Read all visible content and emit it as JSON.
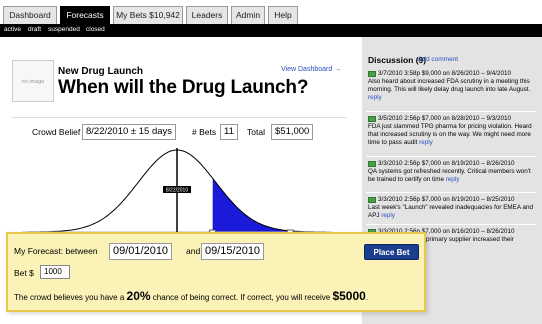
{
  "tabs": [
    {
      "label": "Dashboard",
      "active": false
    },
    {
      "label": "Forecasts",
      "active": true
    },
    {
      "label": "My Bets $10,942",
      "active": false
    },
    {
      "label": "Leaders",
      "active": false
    },
    {
      "label": "Admin",
      "active": false
    },
    {
      "label": "Help",
      "active": false
    }
  ],
  "subnav": [
    "active",
    "draft",
    "suspended",
    "closed"
  ],
  "market": {
    "image_placeholder": "no image",
    "subtitle": "New Drug Launch",
    "title": "When will the Drug Launch?",
    "view_dashboard": "View Dashboard →"
  },
  "stats": {
    "crowd_belief_label": "Crowd Belief",
    "crowd_belief_value": "8/22/2010 ± 15 days",
    "bets_label": "# Bets",
    "bets_value": "11",
    "total_label": "Total",
    "total_value": "$51,000"
  },
  "chart_data": {
    "type": "area",
    "mean_label": "8/22/2010",
    "mean_fraction": 0.5,
    "sigma_fraction": 0.125,
    "selected_range": [
      0.615,
      0.865
    ],
    "colors": {
      "curve": "#000000",
      "selected": "#1a1ad8",
      "mean_line": "#000000"
    }
  },
  "discussion": {
    "title": "Discussion (9)",
    "add_comment": "Add comment",
    "items": [
      {
        "meta": "3/7/2010 3:58p $9,000 on 8/26/2010 – 9/4/2010",
        "text": "Also heard about increased FDA scrutiny in a meeting this morning. This will likely delay drug launch into late August.",
        "reply": "reply"
      },
      {
        "meta": "3/5/2010 2:56p $7,000 on 8/28/2010 – 9/3/2010",
        "text": "FDA just slammed TPG pharma for pricing violation. Heard that increased scrutiny is on the way. We might need more time to pass audit",
        "reply": "reply"
      },
      {
        "meta": "3/3/2010 2:56p $7,000 on 8/19/2010 – 8/26/2010",
        "text": "QA systems got refreshed recently. Critical members won't be trained to certify on time",
        "reply": "reply"
      },
      {
        "meta": "3/3/2010 2:56p $7,000 on 8/19/2010 – 8/25/2010",
        "text": "Last week's \"Launch\" revealed inadequacies for EMEA and APJ",
        "reply": "reply"
      },
      {
        "meta": "3/3/2010 2:56p $7,000 on 8/16/2010 – 8/26/2010",
        "text": "primary supplier increased their",
        "reply": ""
      }
    ]
  },
  "forecast": {
    "label_prefix": "My Forecast: between",
    "date_start": "09/01/2010",
    "and_label": "and",
    "date_end": "09/15/2010",
    "place_bet": "Place Bet",
    "bet_label": "Bet $",
    "bet_value": "1000",
    "odds_prefix": "The crowd believes you have a",
    "odds_value": "20%",
    "odds_middle": "chance of being correct. If correct, you will receive",
    "payout": "$5000",
    "odds_suffix": "."
  }
}
